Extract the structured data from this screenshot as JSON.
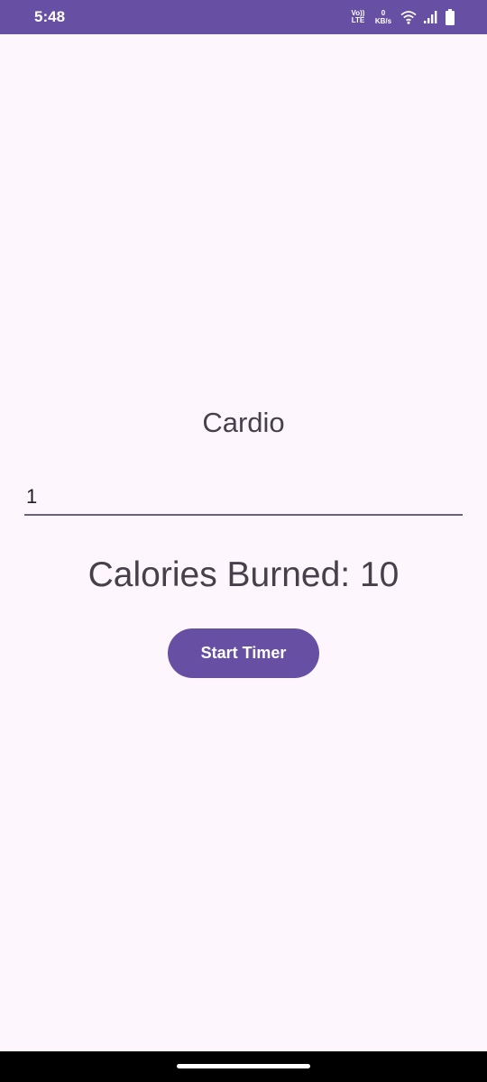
{
  "status_bar": {
    "time": "5:48",
    "volte_line1": "Vo))",
    "volte_line2": "LTE",
    "net_speed_value": "0",
    "net_speed_unit": "KB/s",
    "icons": [
      "volte-icon",
      "wifi-icon",
      "signal-icon",
      "battery-icon"
    ]
  },
  "screen": {
    "title": "Cardio",
    "minutes_input_value": "1",
    "calories_text": "Calories Burned: 10",
    "start_button_label": "Start Timer"
  },
  "colors": {
    "primary": "#6750a4",
    "background": "#fdf7fd",
    "text": "#45404a"
  }
}
